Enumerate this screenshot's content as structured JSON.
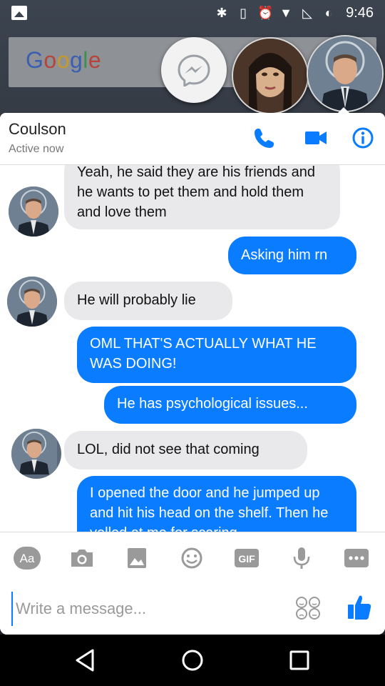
{
  "status_bar": {
    "time": "9:46"
  },
  "home_screen": {
    "google_search_logo": [
      "G",
      "o",
      "o",
      "g",
      "l",
      "e"
    ]
  },
  "chat": {
    "contact_name": "Coulson",
    "contact_status": "Active now",
    "messages": [
      {
        "from": "contact",
        "text": "Yeah, he said they are his friends and he wants to pet them and hold them and love them"
      },
      {
        "from": "me",
        "text": "Asking him rn"
      },
      {
        "from": "contact",
        "text": "He will probably lie"
      },
      {
        "from": "me",
        "text": "OML THAT'S ACTUALLY WHAT HE WAS DOING!"
      },
      {
        "from": "me",
        "text": "He has psychological issues..."
      },
      {
        "from": "contact",
        "text": "LOL, did not see that coming"
      },
      {
        "from": "me",
        "text": "I opened the door and he jumped up and hit his head on the shelf. Then he yelled at me for scaring"
      }
    ],
    "toolbar": {
      "text_label": "Aa",
      "gif_label": "GIF",
      "icons": [
        "text-format-icon",
        "camera-icon",
        "gallery-icon",
        "emoji-icon",
        "gif-icon",
        "microphone-icon",
        "more-icon"
      ]
    },
    "compose": {
      "placeholder": "Write a message..."
    }
  },
  "colors": {
    "accent": "#0a7cff",
    "incoming_bubble": "#e9e9eb",
    "header_icon": "#0a7cff"
  }
}
